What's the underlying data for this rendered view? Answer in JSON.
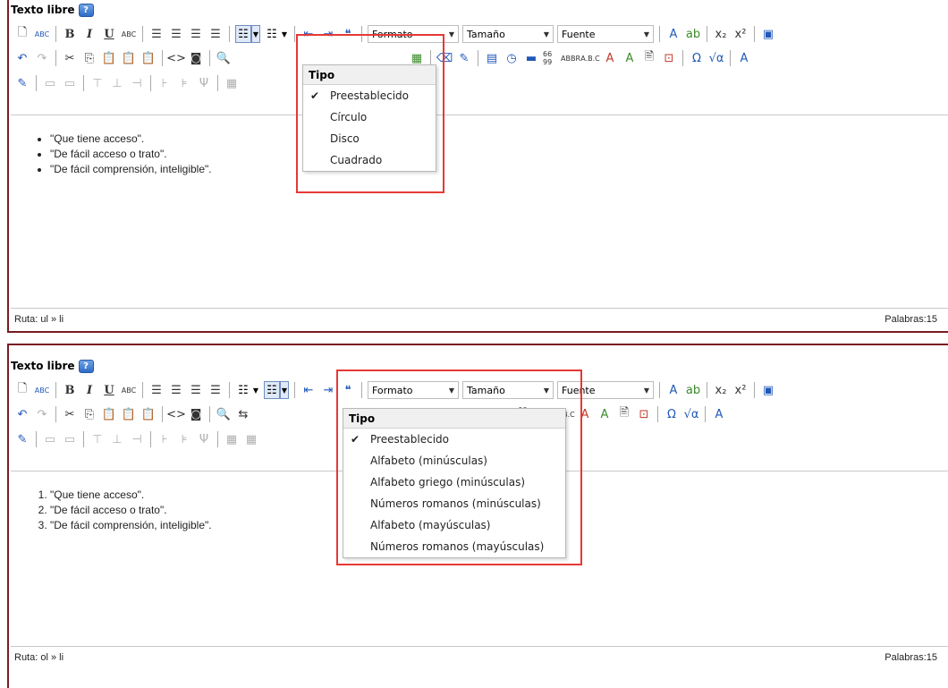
{
  "top": {
    "title": "Texto libre",
    "help_label": "?",
    "combo_formato": "Formato",
    "combo_tamano": "Tamaño",
    "combo_fuente": "Fuente",
    "list_items": [
      "\"Que tiene acceso\".",
      "\"De fácil acceso o trato\".",
      "\"De fácil comprensión, inteligible\"."
    ],
    "status_path": "Ruta: ul » li",
    "status_words": "Palabras:15",
    "dropdown": {
      "header": "Tipo",
      "options": [
        {
          "label": "Preestablecido",
          "checked": true
        },
        {
          "label": "Círculo",
          "checked": false
        },
        {
          "label": "Disco",
          "checked": false
        },
        {
          "label": "Cuadrado",
          "checked": false
        }
      ]
    }
  },
  "bottom": {
    "title": "Texto libre",
    "help_label": "?",
    "combo_formato": "Formato",
    "combo_tamano": "Tamaño",
    "combo_fuente": "Fuente",
    "list_items": [
      "\"Que tiene acceso\".",
      "\"De fácil acceso o trato\".",
      "\"De fácil comprensión, inteligible\"."
    ],
    "status_path": "Ruta: ol » li",
    "status_words": "Palabras:15",
    "dropdown": {
      "header": "Tipo",
      "options": [
        {
          "label": "Preestablecido",
          "checked": true
        },
        {
          "label": "Alfabeto (minúsculas)",
          "checked": false
        },
        {
          "label": "Alfabeto griego (minúsculas)",
          "checked": false
        },
        {
          "label": "Números romanos (minúsculas)",
          "checked": false
        },
        {
          "label": "Alfabeto (mayúsculas)",
          "checked": false
        },
        {
          "label": "Números romanos (mayúsculas)",
          "checked": false
        }
      ]
    }
  },
  "icons": {
    "new_doc": "new-document-icon",
    "spellcheck": "spellcheck-icon",
    "bullet_list": "bullet-list-icon",
    "numbered_list": "numbered-list-icon"
  },
  "colors": {
    "panel_border": "#7a1c22",
    "highlight": "#e53935"
  }
}
